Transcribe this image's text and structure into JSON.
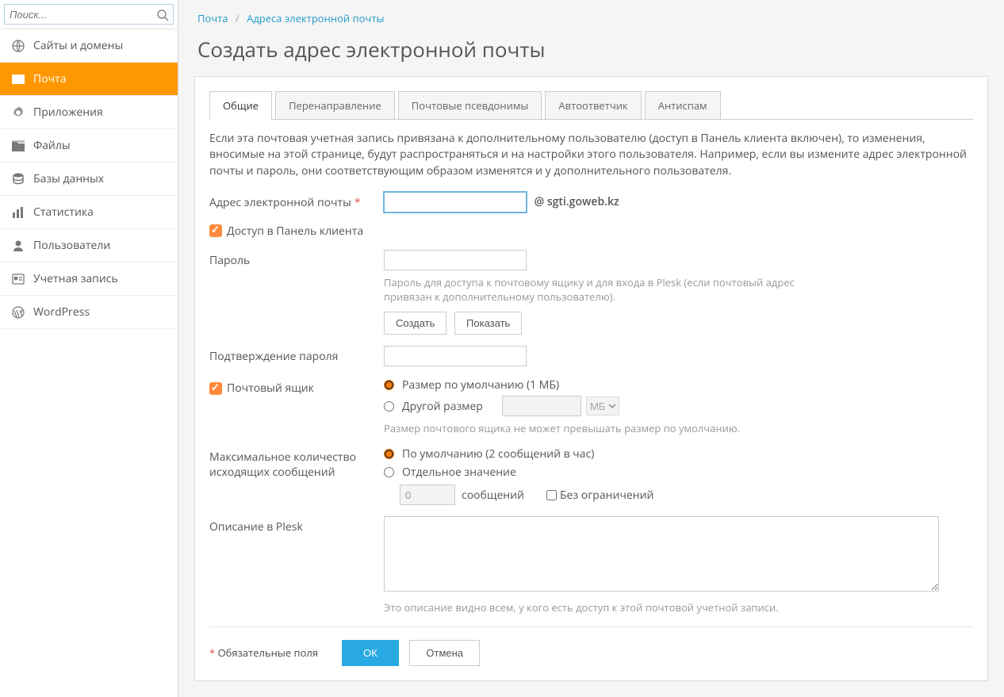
{
  "search": {
    "placeholder": "Поиск..."
  },
  "sidebar": {
    "items": [
      {
        "label": "Сайты и домены"
      },
      {
        "label": "Почта"
      },
      {
        "label": "Приложения"
      },
      {
        "label": "Файлы"
      },
      {
        "label": "Базы данных"
      },
      {
        "label": "Статистика"
      },
      {
        "label": "Пользователи"
      },
      {
        "label": "Учетная запись"
      },
      {
        "label": "WordPress"
      }
    ]
  },
  "crumb": {
    "first": "Почта",
    "second": "Адреса электронной почты"
  },
  "title": "Создать адрес электронной почты",
  "tabs": {
    "items": [
      {
        "label": "Общие"
      },
      {
        "label": "Перенаправление"
      },
      {
        "label": "Почтовые псевдонимы"
      },
      {
        "label": "Автоответчик"
      },
      {
        "label": "Антиспам"
      }
    ]
  },
  "intro": "Если эта почтовая учетная запись привязана к дополнительному пользователю (доступ в Панель клиента включен), то изменения, вносимые на этой странице, будут распространяться и на настройки этого пользователя. Например, если вы измените адрес электронной почты и пароль, они соответствующим образом изменятся и у дополнительного пользователя.",
  "form": {
    "email_label": "Адрес электронной почты",
    "email_value": "",
    "email_domain": "@ sgti.goweb.kz",
    "access_panel": "Доступ в Панель клиента",
    "password_label": "Пароль",
    "password_hint": "Пароль для доступа к почтовому ящику и для входа в Plesk (если почтовый адрес привязан к дополнительному пользователю).",
    "btn_create": "Создать",
    "btn_show": "Показать",
    "confirm_label": "Подтверждение пароля",
    "mailbox_label": "Почтовый ящик",
    "size_default": "Размер по умолчанию (1 МБ)",
    "size_other": "Другой размер",
    "size_unit": "МБ",
    "size_hint": "Размер почтового ящика не может превышать размер по умолчанию.",
    "outgoing_label": "Максимальное количество исходящих сообщений",
    "out_default": "По умолчанию (2 сообщений в час)",
    "out_custom": "Отдельное значение",
    "out_value": "0",
    "out_unit": "сообщений",
    "out_unlim": "Без ограничений",
    "desc_label": "Описание в Plesk",
    "desc_hint": "Это описание видно всем, у кого есть доступ к этой почтовой учетной записи.",
    "required_note": "Обязательные поля",
    "btn_ok": "ОК",
    "btn_cancel": "Отмена"
  }
}
